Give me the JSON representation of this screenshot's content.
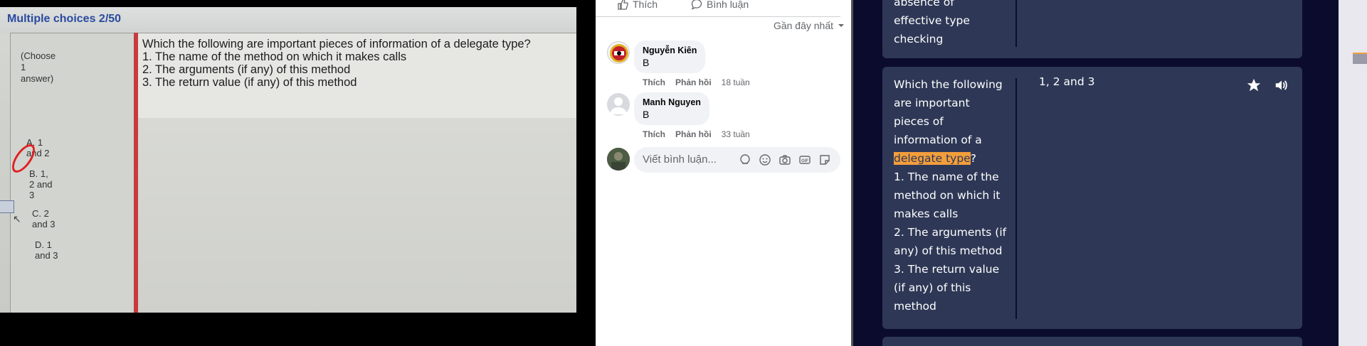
{
  "photo": {
    "title": "Multiple choices 2/50",
    "choose_note": "(Choose\n1\nanswer)",
    "question_lines": [
      "Which the following are important pieces of information of a delegate type?",
      "1. The name of the method on which it makes calls",
      "2. The arguments (if any) of this method",
      "3. The return value (if any) of this method"
    ],
    "options": [
      {
        "label": "A. 1\nand 2"
      },
      {
        "label": "B. 1,\n2 and\n3"
      },
      {
        "label": "C. 2\nand 3"
      },
      {
        "label": "D. 1\nand 3"
      }
    ]
  },
  "facebook": {
    "like_label": "Thích",
    "comment_label": "Bình luận",
    "sort_label": "Gần đây nhất",
    "comments": [
      {
        "name": "Nguyễn Kiên",
        "text": "B",
        "like": "Thích",
        "reply": "Phản hồi",
        "time": "18 tuần"
      },
      {
        "name": "Manh Nguyen",
        "text": "B",
        "like": "Thích",
        "reply": "Phản hồi",
        "time": "33 tuần"
      }
    ],
    "composer_placeholder": "Viết bình luận..."
  },
  "flashcards": {
    "prev_term_lines": [
      "absence of",
      "effective type",
      "checking"
    ],
    "card": {
      "term_before": "Which the following are important pieces of information of a ",
      "term_highlight": "delegate type",
      "term_after": "?",
      "term_lines": [
        "1. The name of the method on which it makes calls",
        "2. The arguments (if any) of this method",
        "3. The return value (if any) of this method"
      ],
      "definition": "1, 2 and 3"
    },
    "highlight_color": "#f39e3c",
    "panel_color": "#2e3856",
    "background_color": "#0b0b2e"
  }
}
